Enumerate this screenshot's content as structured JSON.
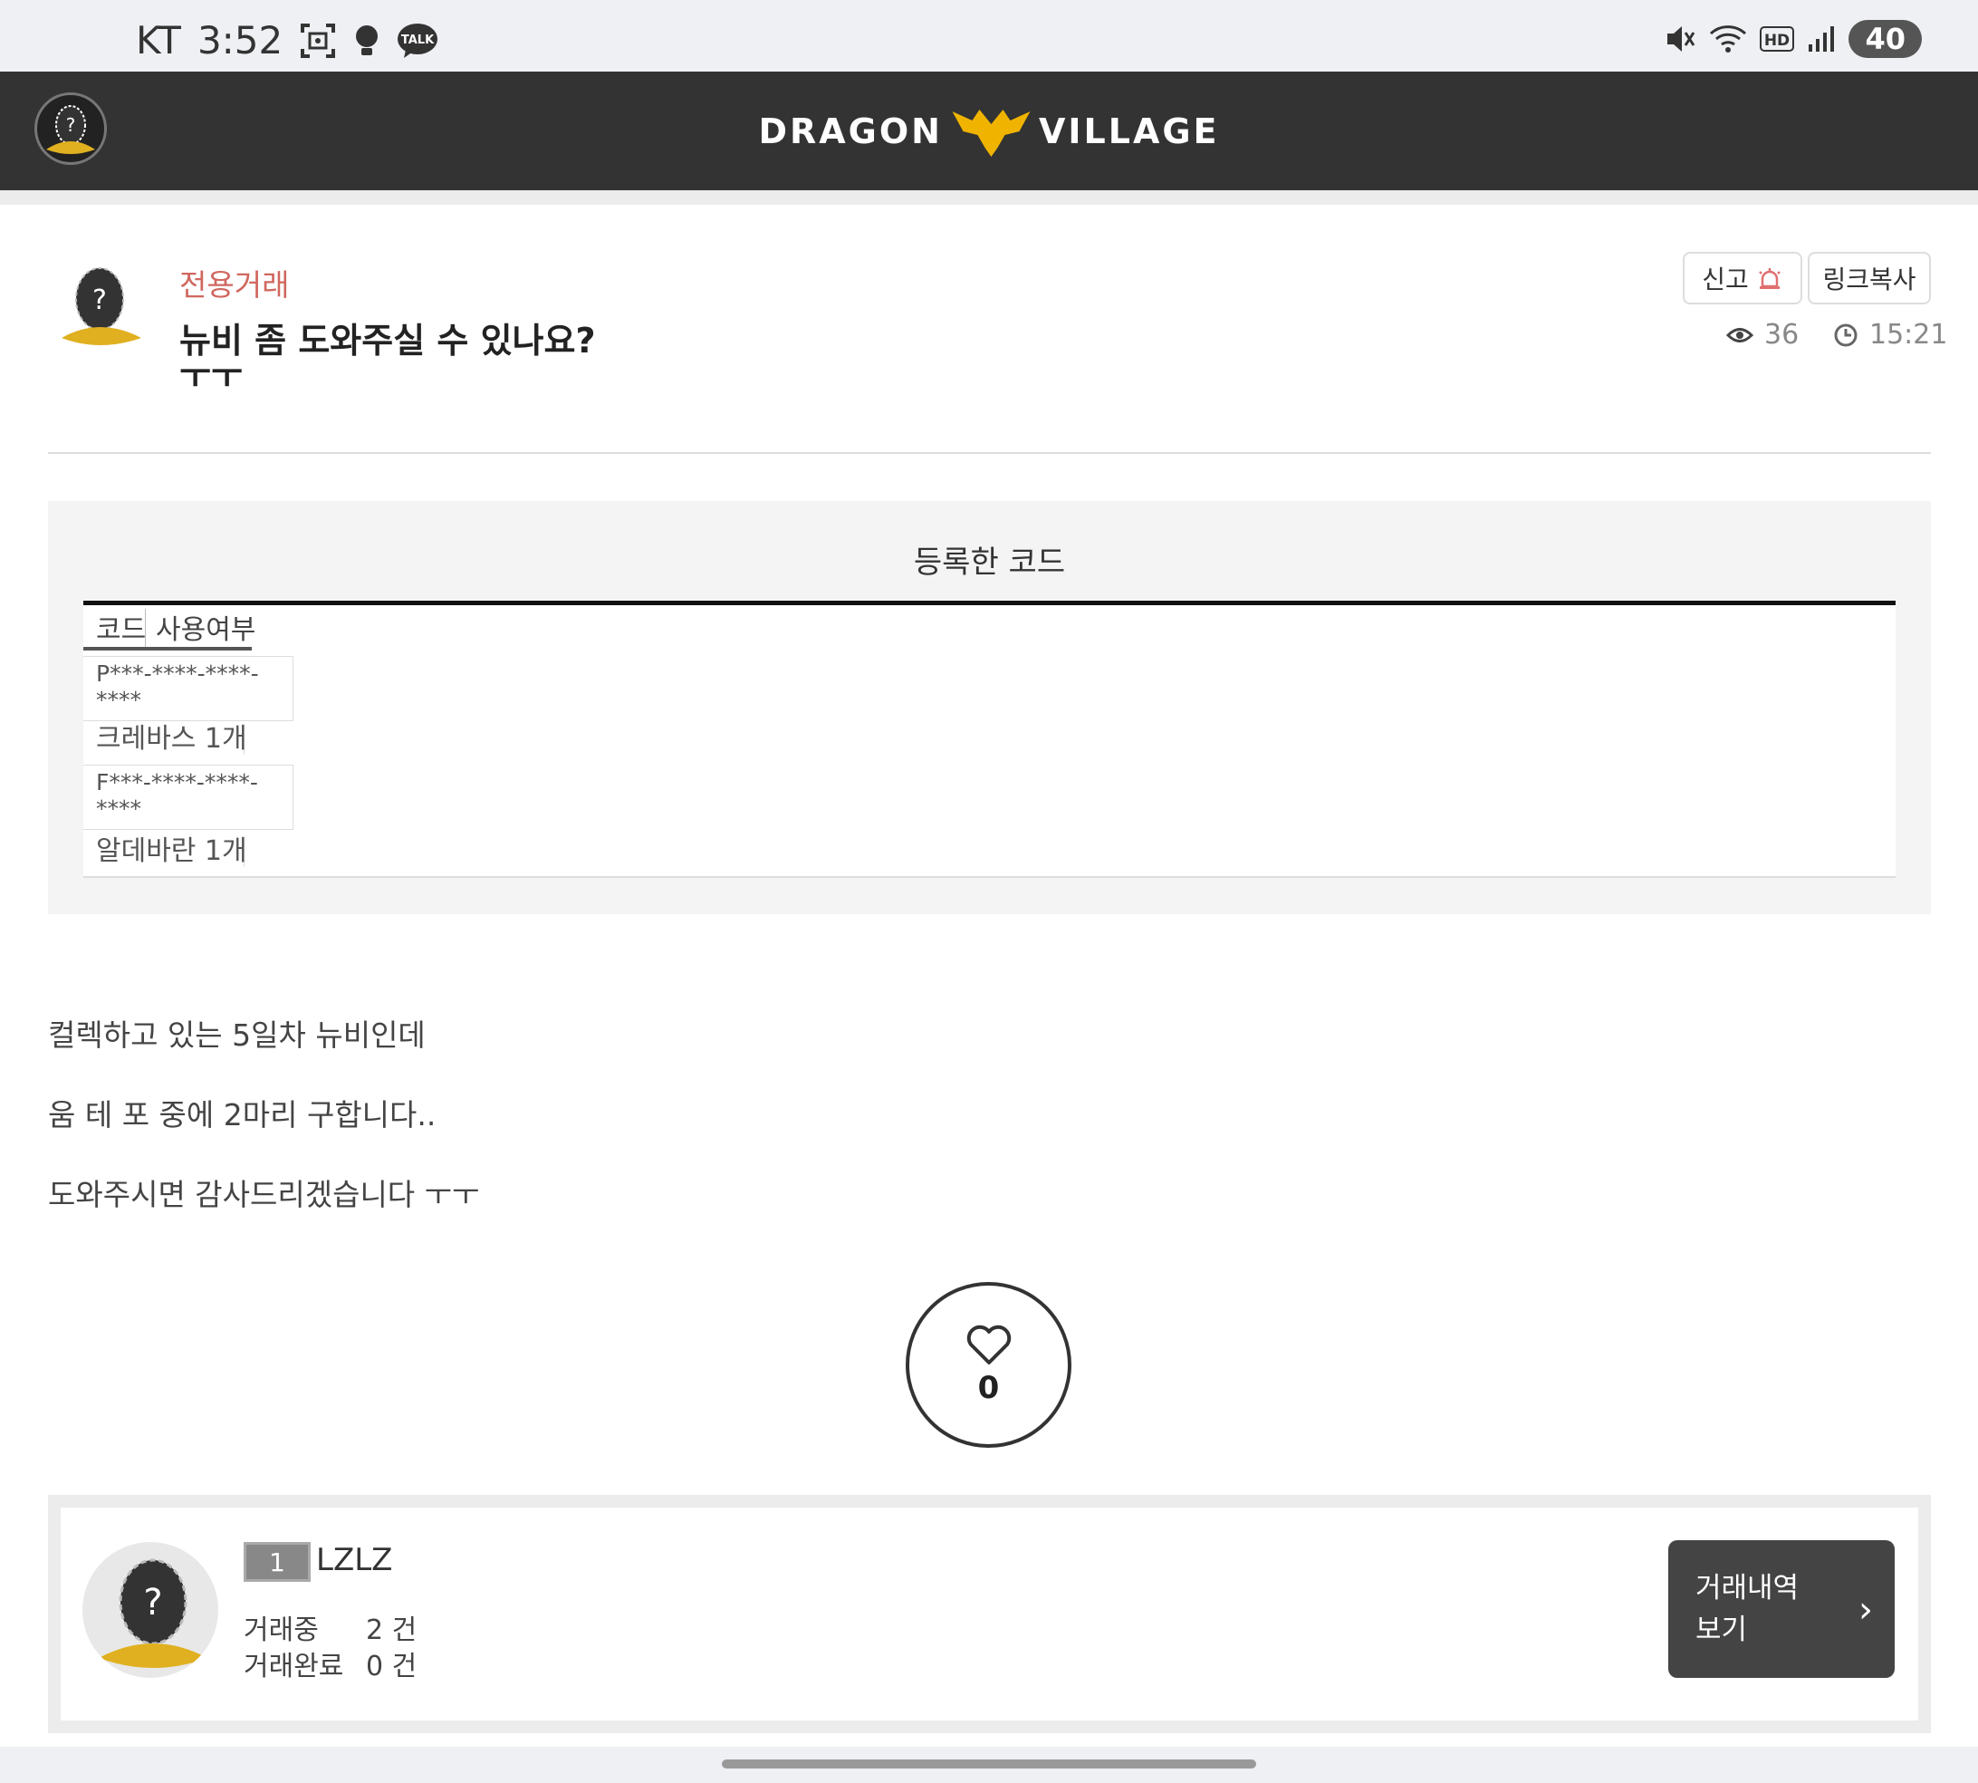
{
  "status_bar": {
    "carrier": "KT",
    "time": "3:52",
    "battery": "40",
    "icons": [
      "screenshot-icon",
      "bulb-icon",
      "kakaotalk-icon",
      "mute-icon",
      "wifi-icon",
      "hd-icon",
      "signal-icon"
    ],
    "talk_label": "TALK",
    "hd_label": "HD"
  },
  "header": {
    "brand_left": "DRAGON",
    "brand_right": "VILLAGE"
  },
  "post": {
    "category": "전용거래",
    "title": "뉴비 좀 도와주실 수 있나요?",
    "title_cont": "ㅜㅜ",
    "report_label": "신고",
    "copy_link_label": "링크복사",
    "views": "36",
    "time": "15:21",
    "category_color": "#d0675f"
  },
  "codes": {
    "heading": "등록한 코드",
    "col_code": "코드",
    "col_used": "사용여부",
    "rows": [
      {
        "code": "P***-****-****-****",
        "item": "크레바스 1개"
      },
      {
        "code": "F***-****-****-****",
        "item": "알데바란 1개"
      }
    ]
  },
  "body": {
    "lines": [
      "컬렉하고 있는 5일차 뉴비인데",
      "움 테 포 중에 2마리 구합니다..",
      "도와주시면 감사드리겠습니다 ㅜㅜ"
    ]
  },
  "like": {
    "count": "0"
  },
  "user": {
    "level": "1",
    "name": "LZLZ",
    "trading_label": "거래중",
    "trading_value": "2 건",
    "completed_label": "거래완료",
    "completed_value": "0 건",
    "history_button_line1": "거래내역",
    "history_button_line2": "보기"
  }
}
